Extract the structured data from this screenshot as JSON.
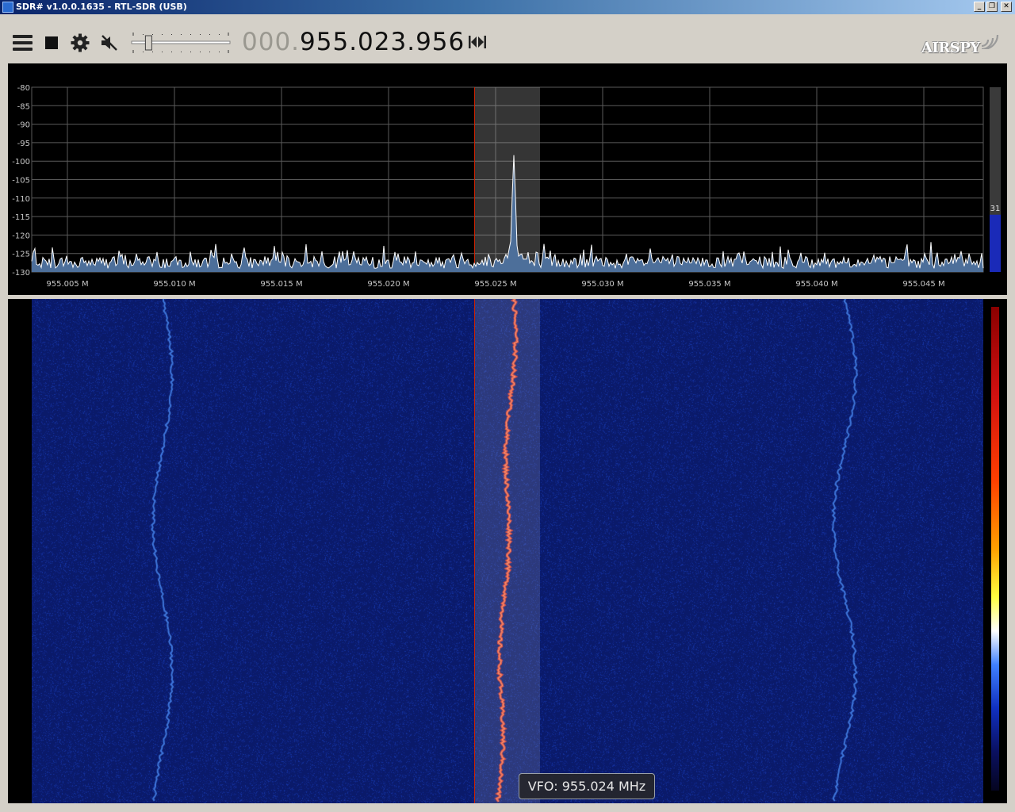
{
  "window": {
    "title": "SDR# v1.0.0.1635 - RTL-SDR (USB)",
    "controls": [
      "_",
      "❐",
      "✕"
    ]
  },
  "toolbar": {
    "icons": [
      "menu-icon",
      "stop-icon",
      "gear-icon",
      "mute-icon",
      "step-icon"
    ],
    "frequency_prefix": "000.",
    "frequency_main": "955.023.956",
    "brand": "AIRSPY",
    "volume_level": 0.15
  },
  "spectrum": {
    "y_ticks": [
      "-80",
      "-85",
      "-90",
      "-95",
      "-100",
      "-105",
      "-110",
      "-115",
      "-120",
      "-125",
      "-130"
    ],
    "x_ticks": [
      "955.005 M",
      "955.010 M",
      "955.015 M",
      "955.020 M",
      "955.025 M",
      "955.030 M",
      "955.035 M",
      "955.040 M",
      "955.045 M"
    ],
    "y_range": [
      -130,
      -80
    ],
    "peak_db": -102.5,
    "noise_floor_db": -128,
    "level_value": "31",
    "colors": {
      "trace": "#ffffff",
      "fill": "#4d6f9a",
      "grid": "#5a5a5a",
      "tick_text": "#c8c8c8",
      "vfo_line": "#cc2200"
    }
  },
  "waterfall": {
    "colors": {
      "background": "#0a1a6a",
      "signal": "#ff4020",
      "faint_signal": "#4a8cff"
    }
  },
  "vfo": {
    "tooltip": "VFO: 955.024 MHz"
  }
}
